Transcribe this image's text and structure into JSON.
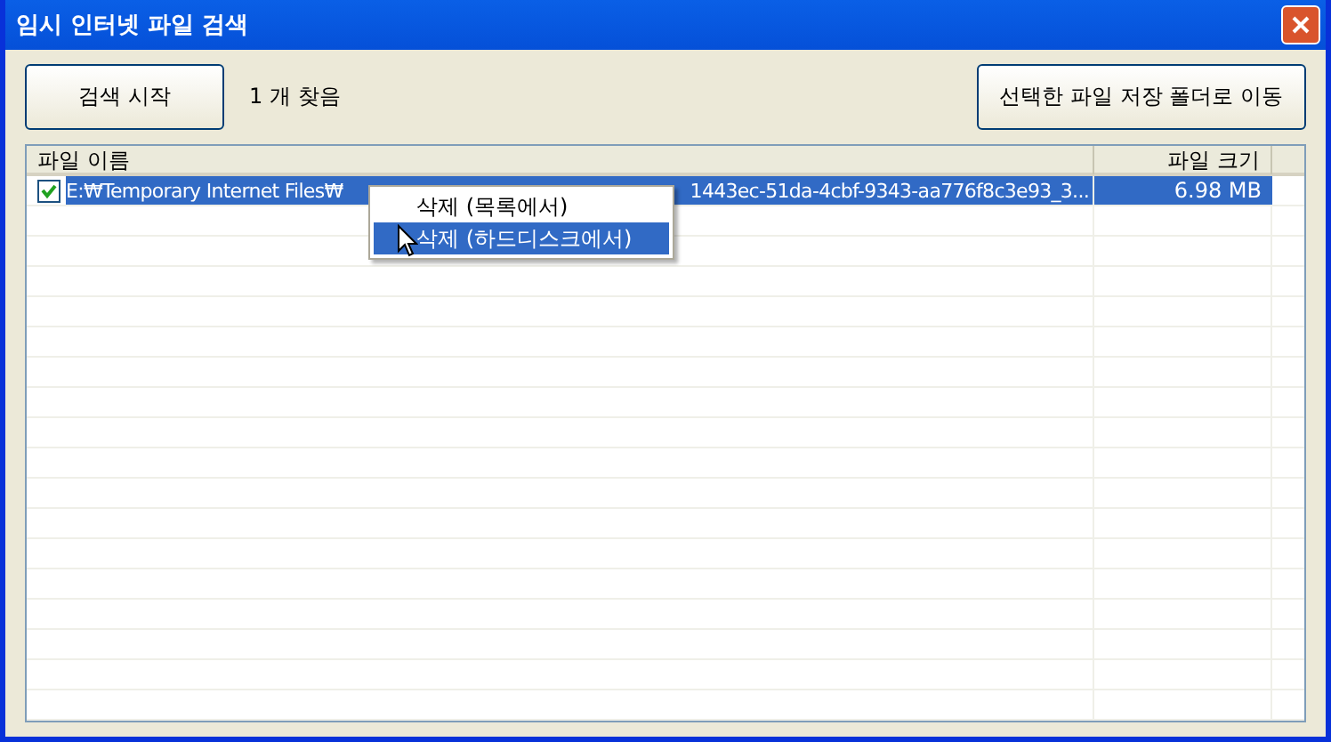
{
  "window": {
    "title": "임시 인터넷 파일 검색"
  },
  "toolbar": {
    "search_button": "검색 시작",
    "result_count": "1 개 찾음",
    "move_button": "선택한 파일 저장 폴더로 이동"
  },
  "table": {
    "columns": [
      "파일 이름",
      "파일 크기"
    ],
    "rows": [
      {
        "checked": true,
        "selected": true,
        "name_start": "E:₩Temporary Internet Files₩",
        "name_end": "1443ec-51da-4cbf-9343-aa776f8c3e93_3...",
        "size": "6.98 MB"
      }
    ]
  },
  "context_menu": {
    "items": [
      {
        "label": "삭제 (목록에서)",
        "selected": false
      },
      {
        "label": "삭제 (하드디스크에서)",
        "selected": true
      }
    ]
  }
}
